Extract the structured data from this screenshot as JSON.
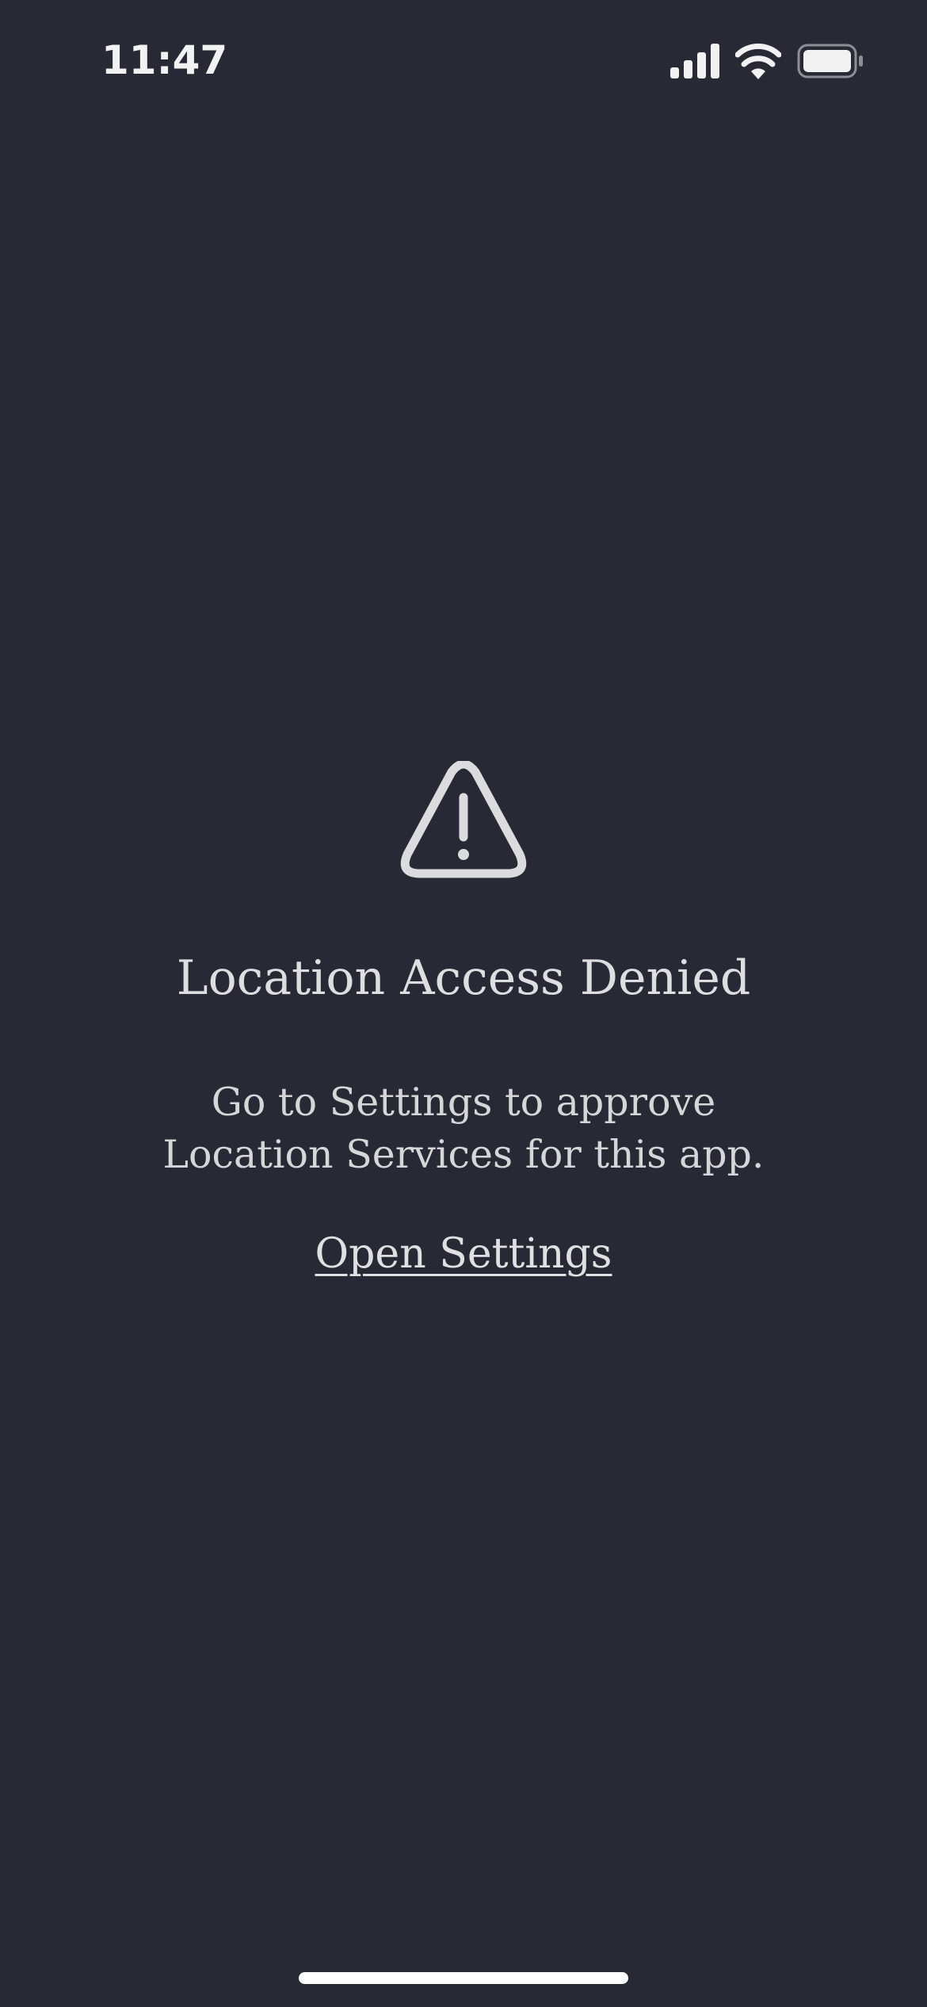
{
  "status_bar": {
    "time": "11:47",
    "icons": [
      "cellular-signal-icon",
      "wifi-icon",
      "battery-icon"
    ]
  },
  "colors": {
    "background": "#272a35",
    "text": "#dcdcde",
    "icon": "#dcdcde"
  },
  "alert": {
    "icon": "warning-triangle-icon",
    "title": "Location Access Denied",
    "message": "Go to Settings to approve Location Services for this app.",
    "action_label": "Open Settings"
  }
}
